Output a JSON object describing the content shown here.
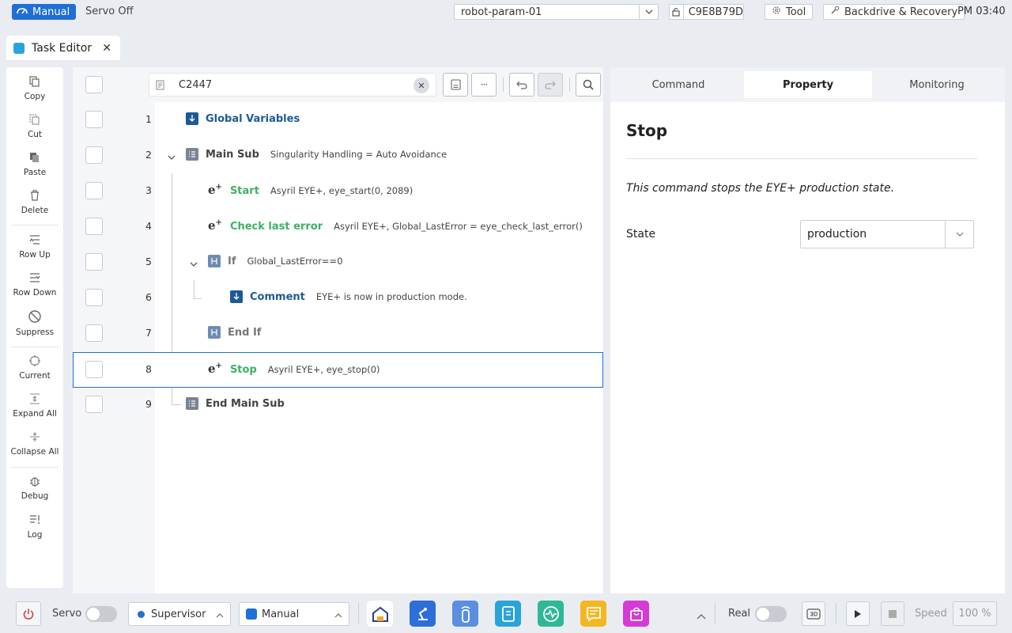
{
  "topbar": {
    "mode": "Manual",
    "servo_status": "Servo Off",
    "param_select": "robot-param-01",
    "device_id": "C9E8B79D",
    "tool_label": "Tool",
    "backdrive_label": "Backdrive & Recovery",
    "clock": "PM 03:40"
  },
  "tab": {
    "title": "Task Editor",
    "close": "✕"
  },
  "left_tools": [
    {
      "name": "copy",
      "label": "Copy"
    },
    {
      "name": "cut",
      "label": "Cut"
    },
    {
      "name": "paste",
      "label": "Paste"
    },
    {
      "name": "delete",
      "label": "Delete"
    },
    {
      "name": "row-up",
      "label": "Row Up"
    },
    {
      "name": "row-down",
      "label": "Row Down"
    },
    {
      "name": "suppress",
      "label": "Suppress"
    },
    {
      "name": "current",
      "label": "Current"
    },
    {
      "name": "expand-all",
      "label": "Expand All"
    },
    {
      "name": "collapse-all",
      "label": "Collapse All"
    },
    {
      "name": "debug",
      "label": "Debug"
    },
    {
      "name": "log",
      "label": "Log"
    }
  ],
  "editor": {
    "search_value": "C2447",
    "rows": [
      {
        "num": "1",
        "name": "Global Variables",
        "arg": ""
      },
      {
        "num": "2",
        "name": "Main Sub",
        "arg": "Singularity Handling = Auto Avoidance"
      },
      {
        "num": "3",
        "name": "Start",
        "arg": "Asyril EYE+, eye_start(0, 2089)"
      },
      {
        "num": "4",
        "name": "Check last error",
        "arg": "Asyril EYE+, Global_LastError = eye_check_last_error()"
      },
      {
        "num": "5",
        "name": "If",
        "arg": "Global_LastError==0"
      },
      {
        "num": "6",
        "name": "Comment",
        "arg": "EYE+ is now in production mode."
      },
      {
        "num": "7",
        "name": "End If",
        "arg": ""
      },
      {
        "num": "8",
        "name": "Stop",
        "arg": "Asyril EYE+, eye_stop(0)"
      },
      {
        "num": "9",
        "name": "End Main Sub",
        "arg": ""
      }
    ],
    "ellipsis": "···"
  },
  "right_panel": {
    "tabs": [
      "Command",
      "Property",
      "Monitoring"
    ],
    "title": "Stop",
    "description": "This command stops the EYE+ production state.",
    "state_label": "State",
    "state_value": "production"
  },
  "bottombar": {
    "servo_label": "Servo",
    "supervisor": "Supervisor",
    "manual": "Manual",
    "real_label": "Real",
    "speed_label": "Speed",
    "speed_value": "100 %"
  },
  "colors": {
    "accent": "#1f6fd6",
    "green": "#3eb065",
    "navy": "#1c5a96"
  }
}
